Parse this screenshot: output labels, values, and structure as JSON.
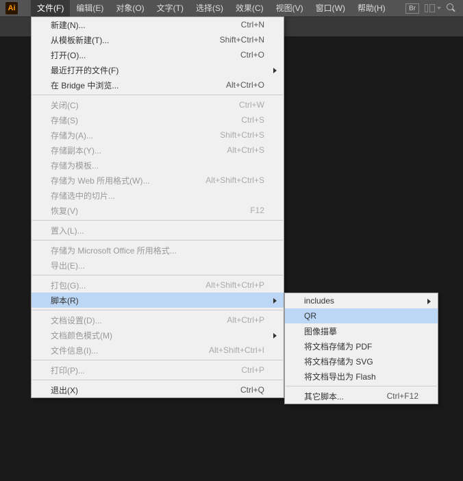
{
  "app": {
    "icon_text": "Ai"
  },
  "menubar": {
    "items": [
      {
        "label": "文件(F)",
        "active": true
      },
      {
        "label": "编辑(E)"
      },
      {
        "label": "对象(O)"
      },
      {
        "label": "文字(T)"
      },
      {
        "label": "选择(S)"
      },
      {
        "label": "效果(C)"
      },
      {
        "label": "视图(V)"
      },
      {
        "label": "窗口(W)"
      },
      {
        "label": "帮助(H)"
      }
    ],
    "br_label": "Br"
  },
  "tools": [
    "selection",
    "direct-selection",
    "magic-wand",
    "lasso",
    "pen",
    "type",
    "line",
    "rectangle",
    "paintbrush",
    "pencil",
    "blob-brush",
    "eraser",
    "rotate",
    "scale",
    "width",
    "free-transform",
    "shape-builder",
    "perspective-grid",
    "mesh",
    "gradient",
    "eyedropper",
    "blend",
    "symbol-sprayer",
    "column-graph",
    "artboard"
  ],
  "file_menu": [
    {
      "label": "新建(N)...",
      "shortcut": "Ctrl+N"
    },
    {
      "label": "从模板新建(T)...",
      "shortcut": "Shift+Ctrl+N"
    },
    {
      "label": "打开(O)...",
      "shortcut": "Ctrl+O"
    },
    {
      "label": "最近打开的文件(F)",
      "submenu": true
    },
    {
      "label": "在 Bridge 中浏览...",
      "shortcut": "Alt+Ctrl+O"
    },
    {
      "sep": true
    },
    {
      "label": "关闭(C)",
      "shortcut": "Ctrl+W",
      "disabled": true
    },
    {
      "label": "存储(S)",
      "shortcut": "Ctrl+S",
      "disabled": true
    },
    {
      "label": "存储为(A)...",
      "shortcut": "Shift+Ctrl+S",
      "disabled": true
    },
    {
      "label": "存储副本(Y)...",
      "shortcut": "Alt+Ctrl+S",
      "disabled": true
    },
    {
      "label": "存储为模板...",
      "disabled": true
    },
    {
      "label": "存储为 Web 所用格式(W)...",
      "shortcut": "Alt+Shift+Ctrl+S",
      "disabled": true
    },
    {
      "label": "存储选中的切片...",
      "disabled": true
    },
    {
      "label": "恢复(V)",
      "shortcut": "F12",
      "disabled": true
    },
    {
      "sep": true
    },
    {
      "label": "置入(L)...",
      "disabled": true
    },
    {
      "sep": true
    },
    {
      "label": "存储为 Microsoft Office 所用格式...",
      "disabled": true
    },
    {
      "label": "导出(E)...",
      "disabled": true
    },
    {
      "sep": true
    },
    {
      "label": "打包(G)...",
      "shortcut": "Alt+Shift+Ctrl+P",
      "disabled": true
    },
    {
      "label": "脚本(R)",
      "submenu": true,
      "highlight": true
    },
    {
      "sep": true
    },
    {
      "label": "文档设置(D)...",
      "shortcut": "Alt+Ctrl+P",
      "disabled": true
    },
    {
      "label": "文档颜色模式(M)",
      "submenu": true,
      "disabled": true
    },
    {
      "label": "文件信息(I)...",
      "shortcut": "Alt+Shift+Ctrl+I",
      "disabled": true
    },
    {
      "sep": true
    },
    {
      "label": "打印(P)...",
      "shortcut": "Ctrl+P",
      "disabled": true
    },
    {
      "sep": true
    },
    {
      "label": "退出(X)",
      "shortcut": "Ctrl+Q"
    }
  ],
  "script_menu": [
    {
      "label": "includes",
      "submenu": true
    },
    {
      "label": "QR",
      "highlight": true
    },
    {
      "label": "图像描摹"
    },
    {
      "label": "将文档存储为 PDF"
    },
    {
      "label": "将文档存储为 SVG"
    },
    {
      "label": "将文档导出为 Flash"
    },
    {
      "sep": true
    },
    {
      "label": "其它脚本...",
      "shortcut": "Ctrl+F12"
    }
  ]
}
